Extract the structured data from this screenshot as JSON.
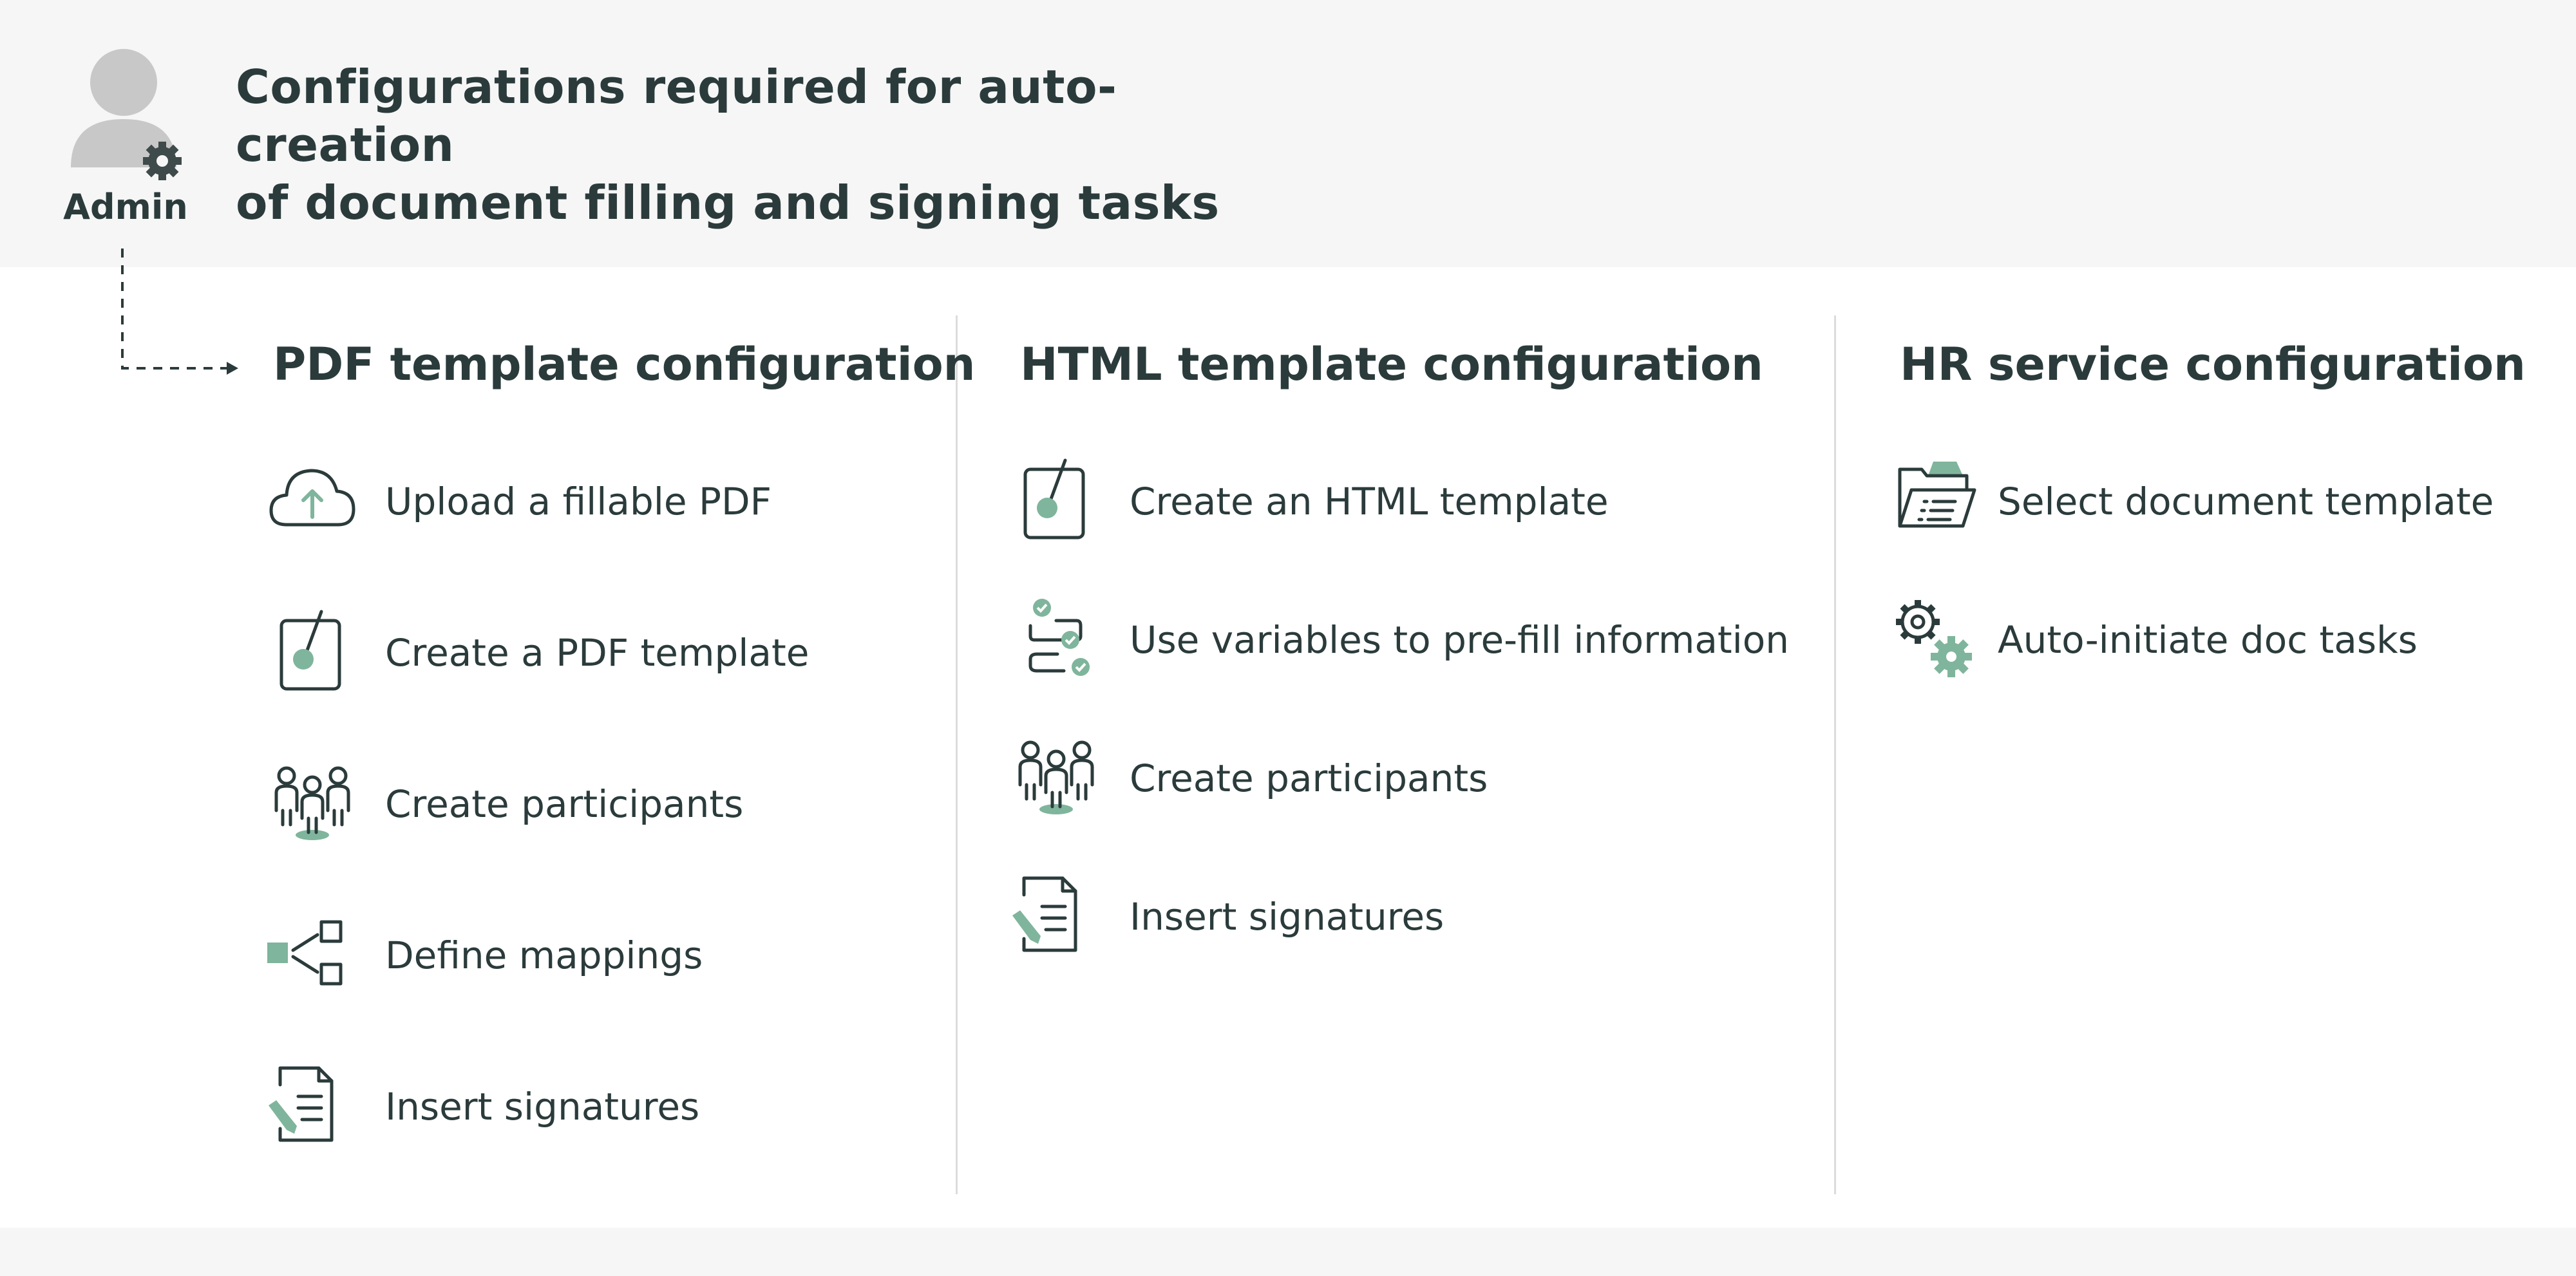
{
  "header": {
    "title_line1": "Configurations required for auto-creation",
    "title_line2": "of document filling and signing tasks",
    "actor_label": "Admin"
  },
  "columns": [
    {
      "heading": "PDF template configuration",
      "items": [
        {
          "label": "Upload a fillable PDF",
          "icon": "cloud-upload-icon"
        },
        {
          "label": "Create a PDF template",
          "icon": "template-brush-icon"
        },
        {
          "label": "Create participants",
          "icon": "participants-icon"
        },
        {
          "label": "Define mappings",
          "icon": "mapping-icon"
        },
        {
          "label": "Insert signatures",
          "icon": "signature-document-icon"
        }
      ]
    },
    {
      "heading": "HTML template configuration",
      "items": [
        {
          "label": "Create an HTML template",
          "icon": "template-brush-icon"
        },
        {
          "label": "Use variables to pre-fill information",
          "icon": "variables-checklist-icon"
        },
        {
          "label": "Create participants",
          "icon": "participants-icon"
        },
        {
          "label": "Insert signatures",
          "icon": "signature-document-icon"
        }
      ]
    },
    {
      "heading": "HR service configuration",
      "items": [
        {
          "label": "Select document template",
          "icon": "folder-document-icon"
        },
        {
          "label": "Auto-initiate doc tasks",
          "icon": "gears-icon"
        }
      ]
    }
  ],
  "colors": {
    "text": "#2b3b3b",
    "accent": "#7fb59c",
    "band": "#f6f6f6",
    "panel": "#ffffff",
    "divider": "#dcdcdc",
    "avatar": "#c8c8c8"
  }
}
